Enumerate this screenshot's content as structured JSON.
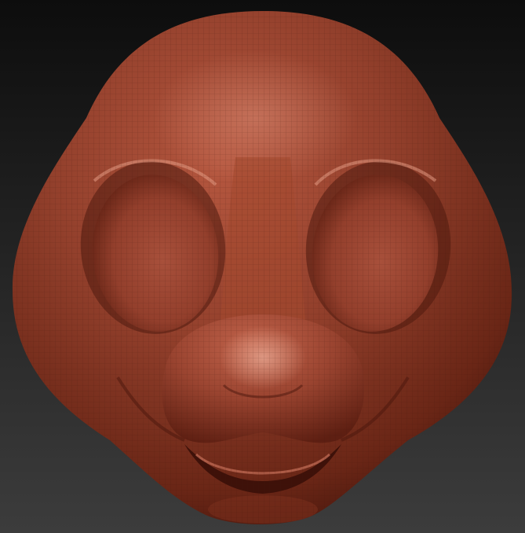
{
  "scene": {
    "background_top": "#0d0d0d",
    "background_bottom": "#3c3c3c",
    "clay_base": "#8f3a28",
    "clay_light": "#c8705a",
    "clay_dark": "#3a130c",
    "wire_color": "#5a1f14"
  },
  "icons": {
    "model": "sculpted-head-icon"
  }
}
